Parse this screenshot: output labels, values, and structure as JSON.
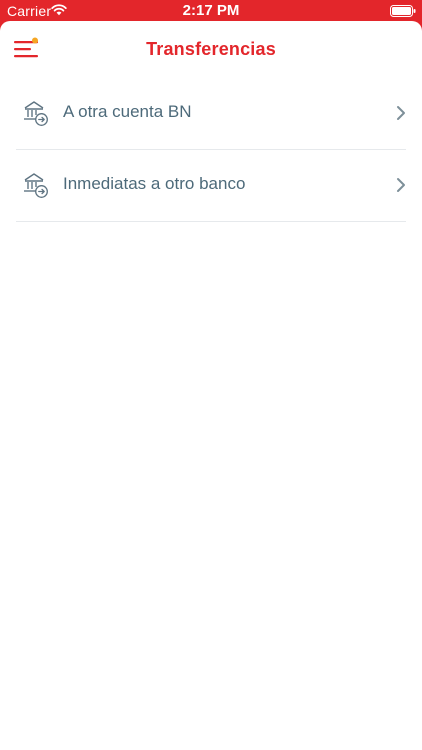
{
  "status_bar": {
    "carrier": "Carrier",
    "time": "2:17 PM",
    "wifi_icon": "wifi-icon",
    "battery_icon": "battery-icon"
  },
  "header": {
    "title": "Transferencias",
    "menu_icon": "hamburger-menu-icon",
    "notification_dot_color": "#f5a623"
  },
  "options": [
    {
      "label": "A otra cuenta BN",
      "icon": "bank-transfer-icon"
    },
    {
      "label": "Inmediatas a otro banco",
      "icon": "bank-transfer-icon"
    }
  ],
  "colors": {
    "brand_red": "#e3262b",
    "label_text": "#4d6a7a",
    "divider": "#e6e9ec",
    "icon_gray": "#5f7482"
  }
}
